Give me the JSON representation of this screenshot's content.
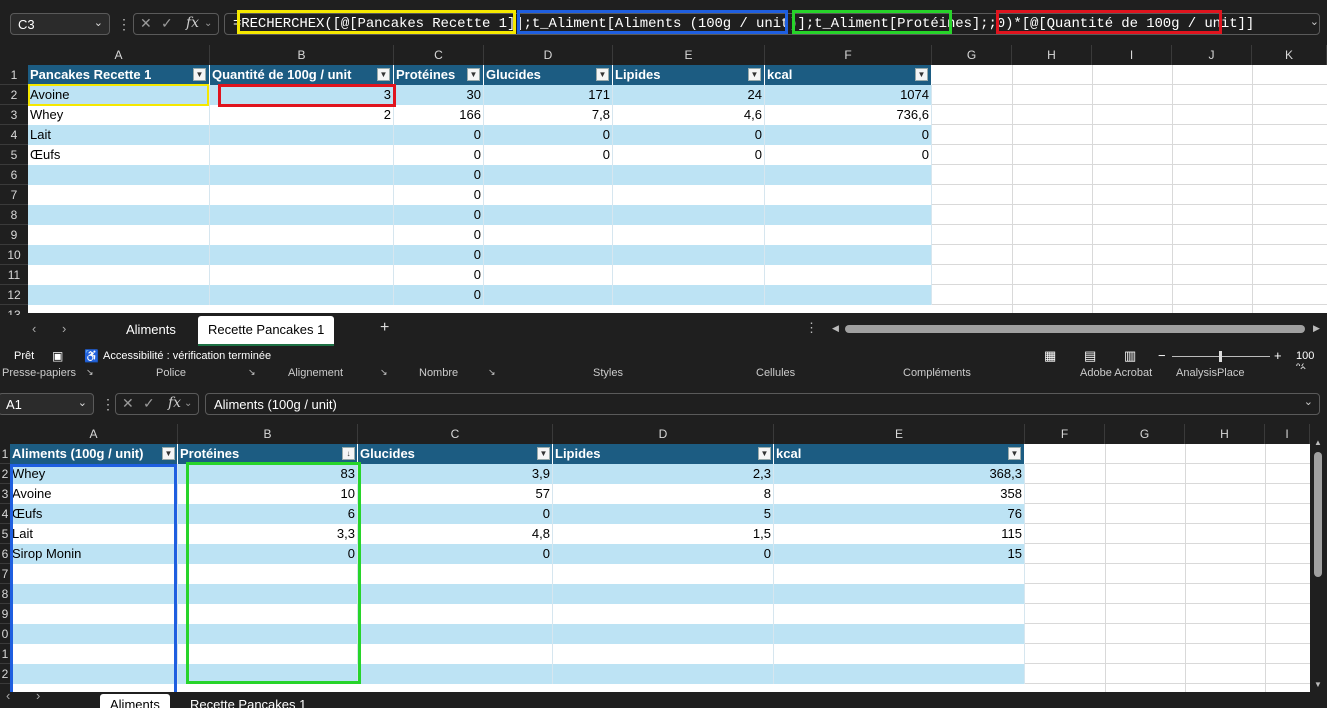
{
  "top": {
    "namebox": "C3",
    "formula_parts": [
      "=RECHERCHEX([@[Pancakes Recette 1]]",
      ";",
      "t_Aliment[Aliments (100g / unit)]",
      ";",
      "t_Aliment[Protéines]",
      ";;0)*",
      "[@[Quantité de 100g / unit]]"
    ],
    "columns": [
      "A",
      "B",
      "C",
      "D",
      "E",
      "F",
      "G",
      "H",
      "I",
      "J",
      "K"
    ],
    "rows": [
      "1",
      "2",
      "3",
      "4",
      "5",
      "6",
      "7",
      "8",
      "9",
      "10",
      "11",
      "12",
      "13"
    ],
    "headers": [
      "Pancakes Recette 1",
      "Quantité de 100g / unit",
      "Protéines",
      "Glucides",
      "Lipides",
      "kcal"
    ],
    "data": [
      [
        "Avoine",
        "3",
        "30",
        "171",
        "24",
        "1074"
      ],
      [
        "Whey",
        "2",
        "166",
        "7,8",
        "4,6",
        "736,6"
      ],
      [
        "Lait",
        "",
        "0",
        "0",
        "0",
        "0"
      ],
      [
        "Œufs",
        "",
        "0",
        "0",
        "0",
        "0"
      ],
      [
        "",
        "",
        "0",
        "",
        "",
        ""
      ],
      [
        "",
        "",
        "0",
        "",
        "",
        ""
      ],
      [
        "",
        "",
        "0",
        "",
        "",
        ""
      ],
      [
        "",
        "",
        "0",
        "",
        "",
        ""
      ],
      [
        "",
        "",
        "0",
        "",
        "",
        ""
      ],
      [
        "",
        "",
        "0",
        "",
        "",
        ""
      ],
      [
        "",
        "",
        "0",
        "",
        "",
        ""
      ]
    ],
    "tabs": [
      "Aliments",
      "Recette Pancakes 1"
    ],
    "active_tab": "Recette Pancakes 1"
  },
  "status": {
    "ready": "Prêt",
    "accessibility": "Accessibilité : vérification terminée",
    "zoom": "100 %"
  },
  "ribbon_groups": [
    "Presse-papiers",
    "Police",
    "Alignement",
    "Nombre",
    "Styles",
    "Cellules",
    "Compléments",
    "Adobe Acrobat",
    "AnalysisPlace"
  ],
  "bottom": {
    "namebox": "A1",
    "formula": "Aliments (100g / unit)",
    "columns": [
      "A",
      "B",
      "C",
      "D",
      "E",
      "F",
      "G",
      "H",
      "I"
    ],
    "rows": [
      "1",
      "2",
      "3",
      "4",
      "5",
      "6",
      "7",
      "8",
      "9",
      "0",
      "1",
      "2"
    ],
    "headers": [
      "Aliments (100g / unit)",
      "Protéines",
      "Glucides",
      "Lipides",
      "kcal"
    ],
    "data": [
      [
        "Whey",
        "83",
        "3,9",
        "2,3",
        "368,3"
      ],
      [
        "Avoine",
        "10",
        "57",
        "8",
        "358"
      ],
      [
        "Œufs",
        "6",
        "0",
        "5",
        "76"
      ],
      [
        "Lait",
        "3,3",
        "4,8",
        "1,5",
        "115"
      ],
      [
        "Sirop Monin",
        "0",
        "0",
        "0",
        "15"
      ]
    ],
    "tabs": [
      "Aliments",
      "Recette Pancakes 1"
    ],
    "active_tab": "Aliments"
  },
  "colors": {
    "header": "#1c5c82",
    "band": "#bde3f4",
    "yellow": "#f5e800",
    "blue": "#1f5fe0",
    "green": "#27d42a",
    "red": "#e0141e"
  }
}
